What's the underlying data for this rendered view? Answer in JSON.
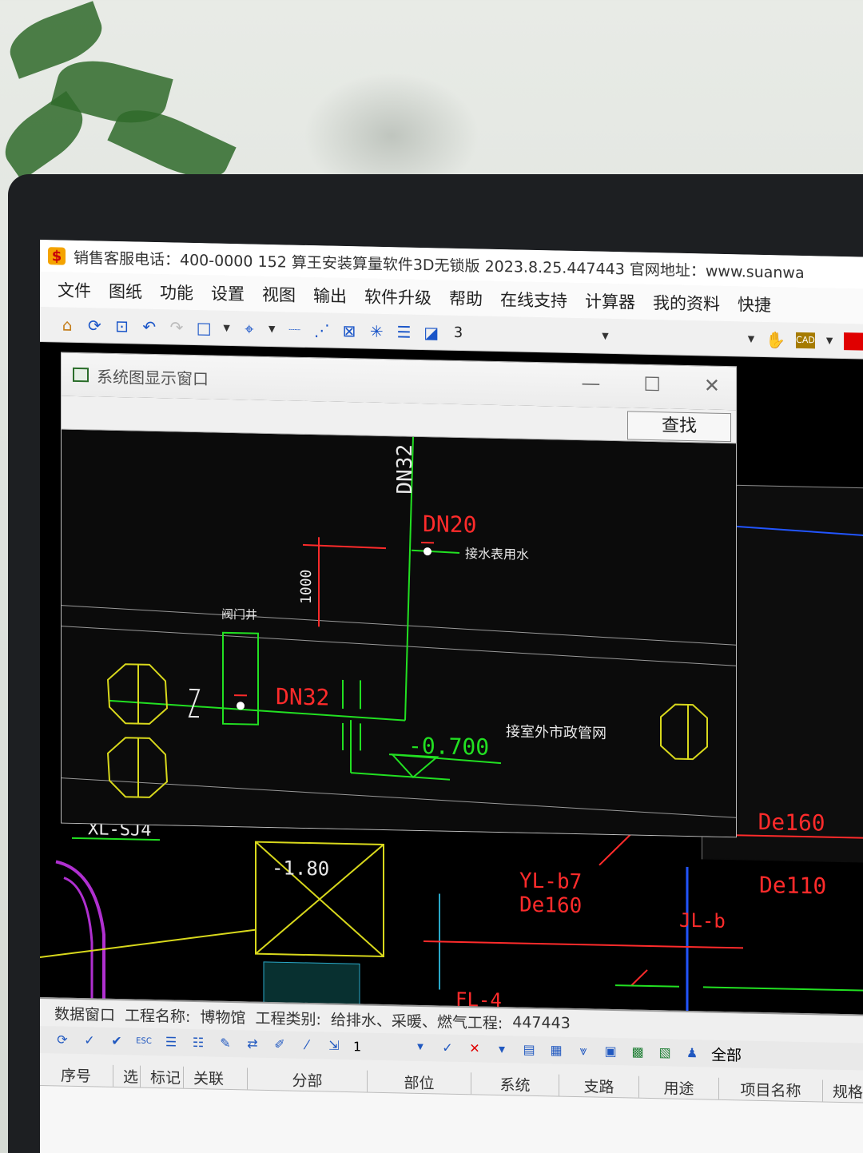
{
  "app": {
    "title_text": "销售客服电话：400-0000 152    算王安装算量软件3D无锁版 2023.8.25.447443 官网地址：www.suanwa"
  },
  "menu": [
    "文件",
    "图纸",
    "功能",
    "设置",
    "视图",
    "输出",
    "软件升级",
    "帮助",
    "在线支持",
    "计算器",
    "我的资料",
    "快捷"
  ],
  "toolbar": {
    "icons": [
      "home-icon",
      "refresh-icon",
      "zoom-extent-icon",
      "undo-icon",
      "redo-icon",
      "rectangle-icon",
      "crosshair-icon",
      "linetype-icon",
      "snap-icon",
      "delete-icon",
      "star-icon",
      "layers-icon",
      "edit-icon"
    ],
    "layer_value": "3",
    "cad_badge": "CAD",
    "color_swatch": "#e00000"
  },
  "system_window": {
    "title": "系统图显示窗口",
    "find_button": "查找",
    "labels": {
      "dn32_vertical": "DN32",
      "dn20": "DN20",
      "dn32": "DN32",
      "height_1000": "1000",
      "elevation": "-0.700",
      "valve_well": "阀门井",
      "to_water_unit": "接水表用水",
      "to_municipal": "接室外市政管网"
    }
  },
  "background_labels": {
    "xl_sj4": "XL-SJ4",
    "elev_180": "-1.80",
    "yl_b7": "YL-b7",
    "de160_a": "De160",
    "de160_b": "De160",
    "de110": "De110",
    "jl_b": "JL-b",
    "fl_4": "FL-4"
  },
  "data_window": {
    "title": "数据窗口",
    "project_name_label": "工程名称:",
    "project_name": "博物馆",
    "project_type_label": "工程类别:",
    "project_type": "给排水、采暖、燃气工程:",
    "project_code": "447443",
    "page_value": "1",
    "all_label": "全部",
    "columns": [
      "序号",
      "选",
      "标记",
      "关联",
      "分部",
      "部位",
      "系统",
      "支路",
      "用途",
      "项目名称",
      "规格"
    ]
  },
  "colors": {
    "pipe_green": "#22e022",
    "dim_red": "#ff2b2b",
    "symbol_yellow": "#d8d81c",
    "cad_bg": "#0b0b0b"
  }
}
